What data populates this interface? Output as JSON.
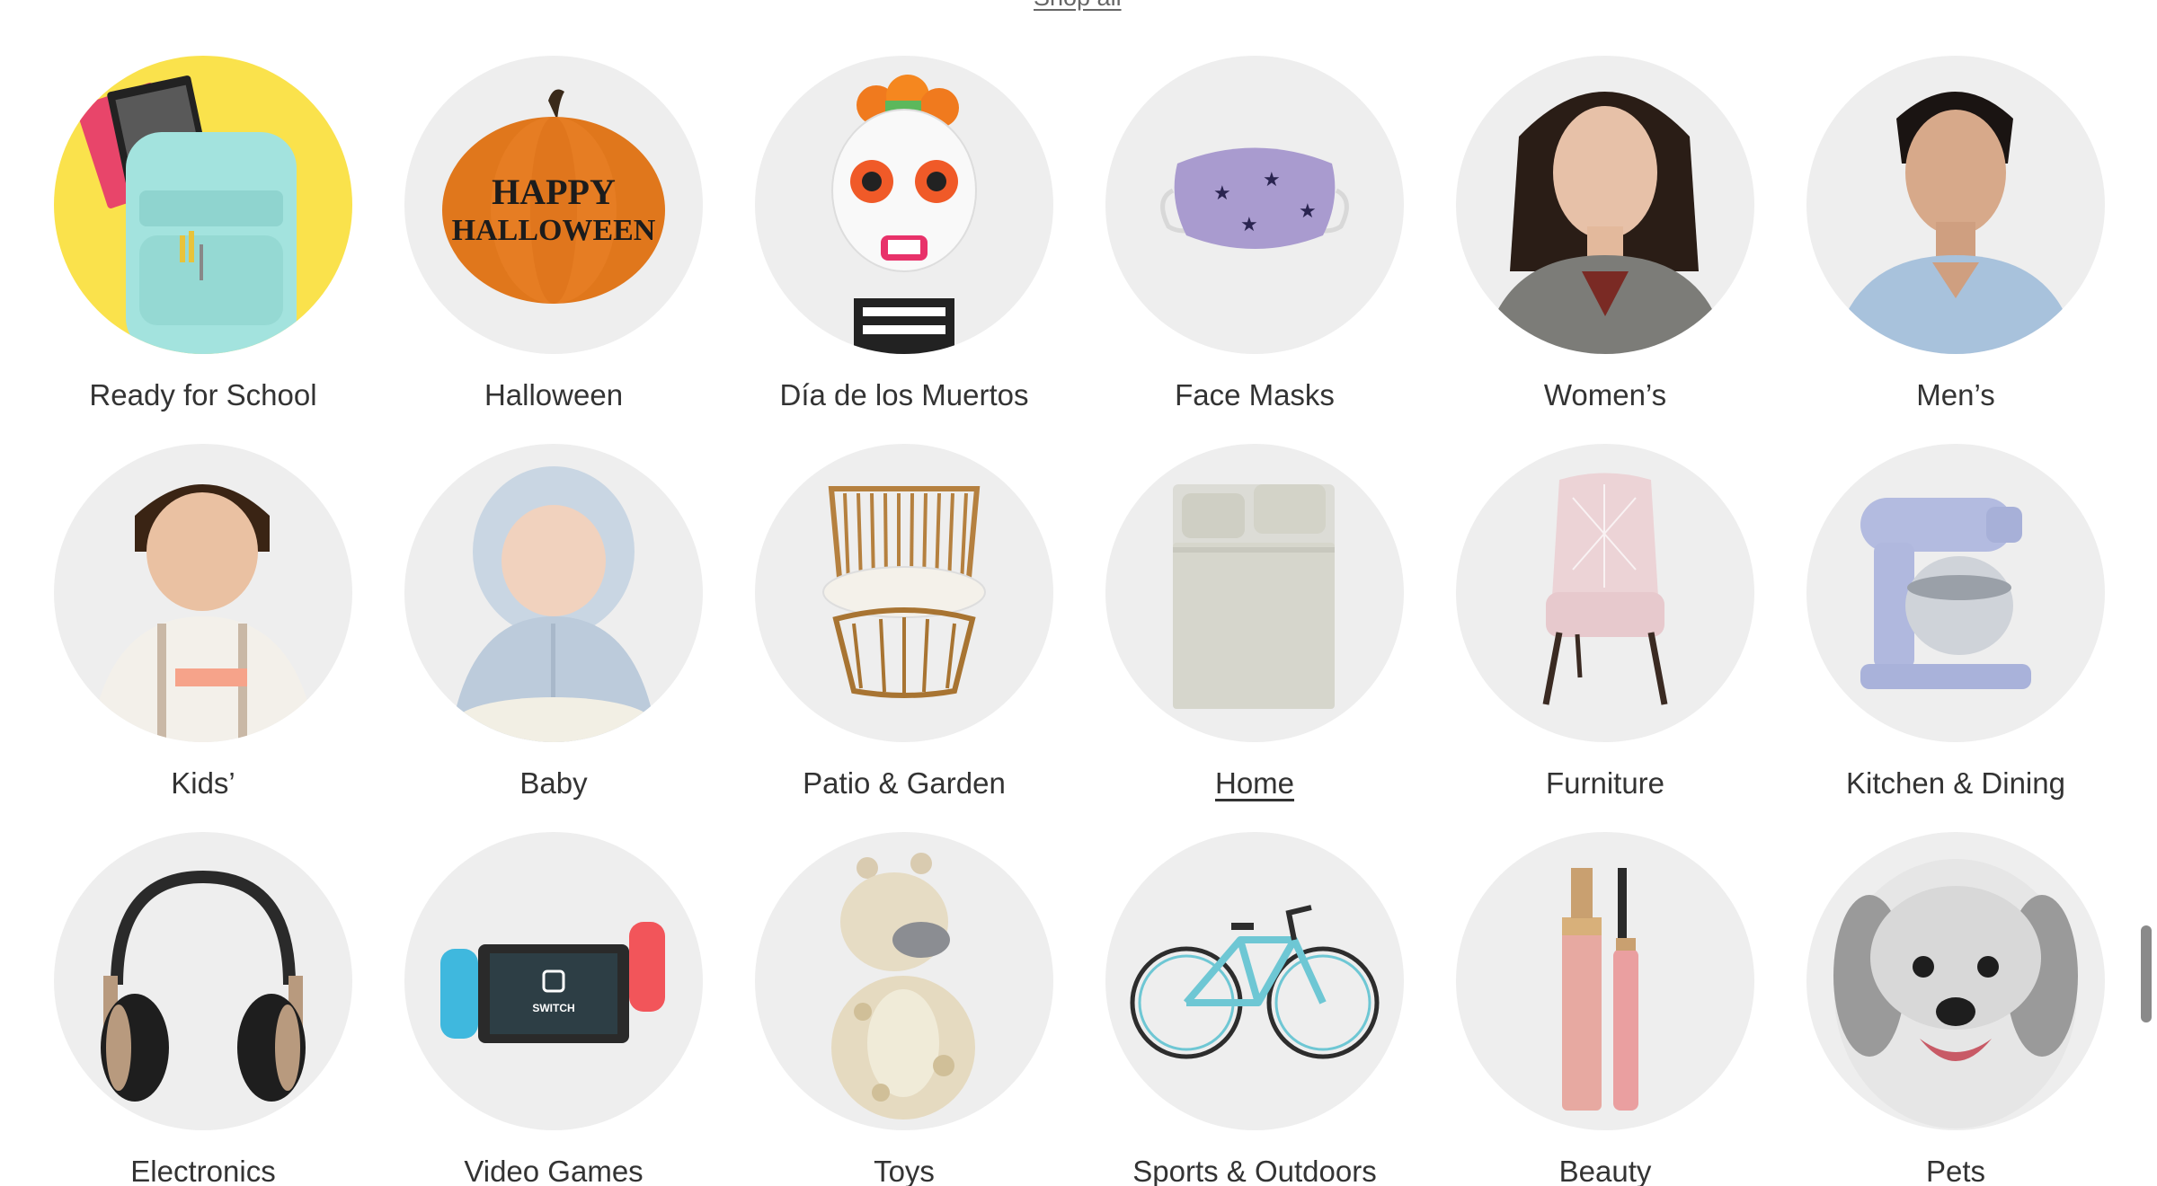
{
  "shop_all_label": "Shop all",
  "categories": [
    {
      "label": "Ready for School",
      "icon": "backpack-icon"
    },
    {
      "label": "Halloween",
      "icon": "pumpkin-icon"
    },
    {
      "label": "Día de los Muertos",
      "icon": "sugar-skull-icon"
    },
    {
      "label": "Face Masks",
      "icon": "face-mask-icon"
    },
    {
      "label": "Women’s",
      "icon": "woman-portrait-icon"
    },
    {
      "label": "Men’s",
      "icon": "man-portrait-icon"
    },
    {
      "label": "Kids’",
      "icon": "kid-portrait-icon"
    },
    {
      "label": "Baby",
      "icon": "baby-portrait-icon"
    },
    {
      "label": "Patio & Garden",
      "icon": "rattan-chair-icon"
    },
    {
      "label": "Home",
      "icon": "bed-icon",
      "active": true
    },
    {
      "label": "Furniture",
      "icon": "accent-chair-icon"
    },
    {
      "label": "Kitchen & Dining",
      "icon": "stand-mixer-icon"
    },
    {
      "label": "Electronics",
      "icon": "headphones-icon"
    },
    {
      "label": "Video Games",
      "icon": "game-console-icon"
    },
    {
      "label": "Toys",
      "icon": "plush-giraffe-icon"
    },
    {
      "label": "Sports & Outdoors",
      "icon": "bicycle-icon"
    },
    {
      "label": "Beauty",
      "icon": "mascara-icon"
    },
    {
      "label": "Pets",
      "icon": "dog-icon"
    }
  ],
  "pumpkin_text": [
    "HAPPY",
    "HALLOWEEN"
  ],
  "console_brand": "SWITCH",
  "colors": {
    "circle_bg": "#eeeeee",
    "school_bg": "#fae24c",
    "label_text": "#333333"
  }
}
